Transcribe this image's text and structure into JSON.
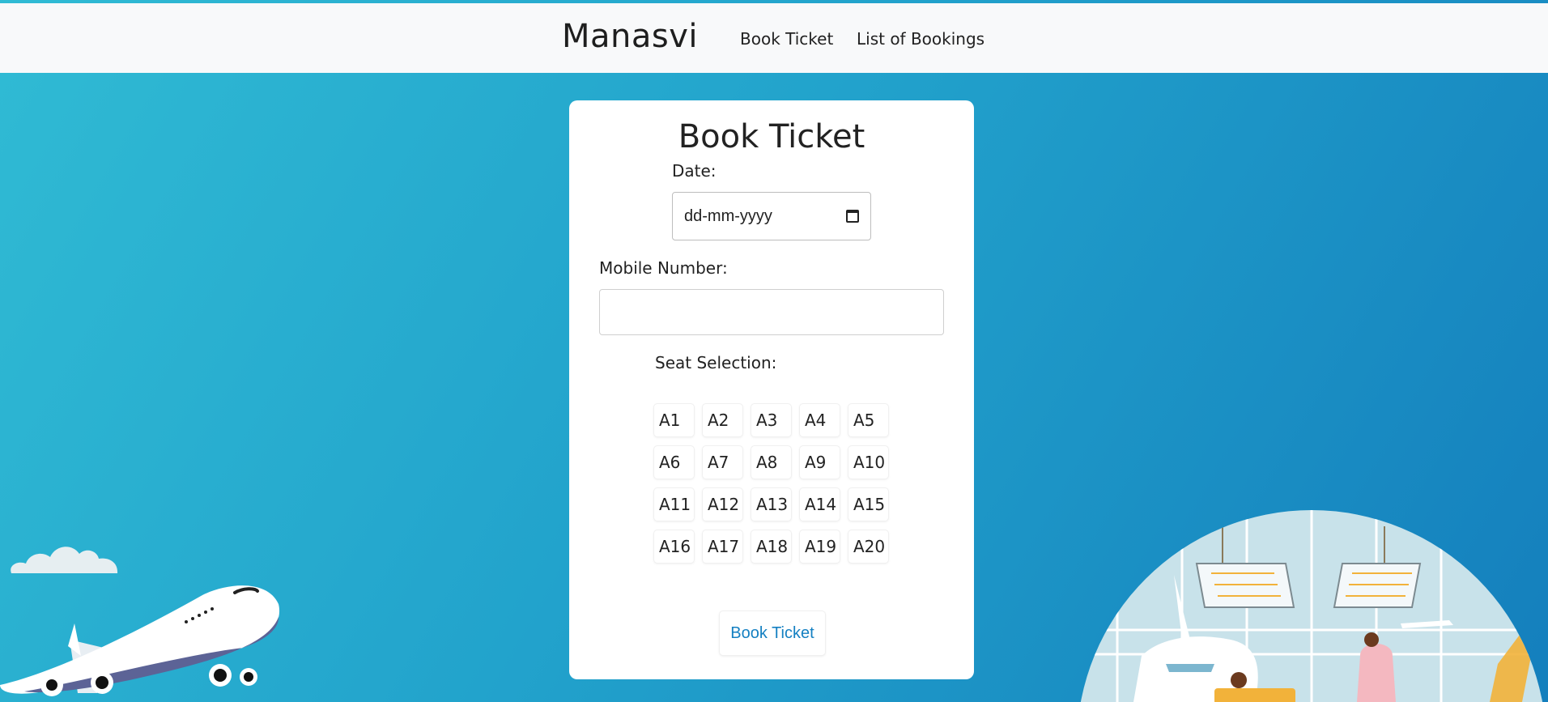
{
  "nav": {
    "brand": "Manasvi",
    "links": [
      "Book Ticket",
      "List of Bookings"
    ]
  },
  "form": {
    "title": "Book Ticket",
    "date_label": "Date:",
    "date_placeholder": "dd-mm-yyyy",
    "mobile_label": "Mobile Number:",
    "mobile_value": "",
    "seat_label": "Seat Selection:",
    "seats": [
      "A1",
      "A2",
      "A3",
      "A4",
      "A5",
      "A6",
      "A7",
      "A8",
      "A9",
      "A10",
      "A11",
      "A12",
      "A13",
      "A14",
      "A15",
      "A16",
      "A17",
      "A18",
      "A19",
      "A20"
    ],
    "submit_label": "Book Ticket"
  },
  "icons": [
    "calendar-icon"
  ],
  "colors": {
    "navbar_bg": "#f8f9fa",
    "bg_gradient_start": "#30bbd4",
    "bg_gradient_end": "#147fbd",
    "button_text": "#1580c2"
  }
}
